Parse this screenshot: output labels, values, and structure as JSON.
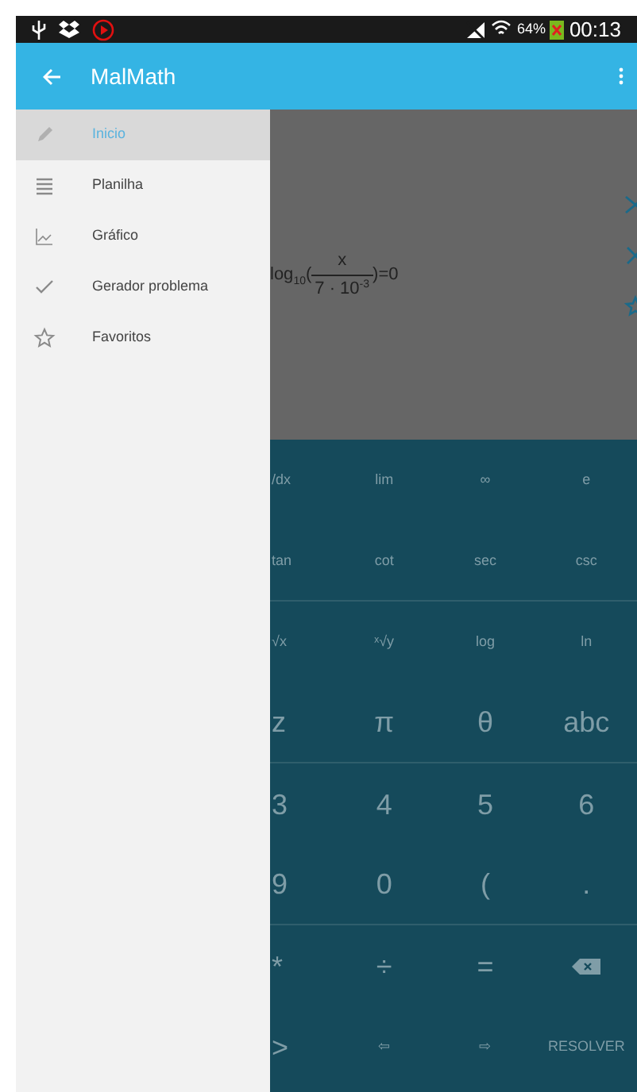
{
  "status_bar": {
    "battery_text": "64%",
    "time": "00:13"
  },
  "app_bar": {
    "title": "MalMath"
  },
  "drawer": {
    "items": [
      {
        "label": "Inicio",
        "selected": true,
        "kind": "pencil"
      },
      {
        "label": "Planilha",
        "selected": false,
        "kind": "list"
      },
      {
        "label": "Gráfico",
        "selected": false,
        "kind": "chart"
      },
      {
        "label": "Gerador problema",
        "selected": false,
        "kind": "check"
      },
      {
        "label": "Favoritos",
        "selected": false,
        "kind": "star"
      }
    ]
  },
  "equation": {
    "func": "log",
    "base": "10",
    "open": "(",
    "numerator": "x",
    "denominator": "7 · 10",
    "exponent": "-3",
    "tail": ")=0"
  },
  "keypad": {
    "rows": [
      [
        {
          "label": "/dx",
          "kind": "fn"
        },
        {
          "label": "lim",
          "kind": "fn"
        },
        {
          "label": "∞",
          "kind": "fn"
        },
        {
          "label": "e",
          "kind": "fn"
        }
      ],
      [
        {
          "label": "tan",
          "kind": "fn"
        },
        {
          "label": "cot",
          "kind": "fn"
        },
        {
          "label": "sec",
          "kind": "fn"
        },
        {
          "label": "csc",
          "kind": "fn"
        }
      ],
      [
        {
          "label": "√x",
          "kind": "fn"
        },
        {
          "label": "ˣ√y",
          "kind": "fn"
        },
        {
          "label": "log",
          "kind": "fn"
        },
        {
          "label": "ln",
          "kind": "fn"
        }
      ],
      [
        {
          "label": "z",
          "kind": "big"
        },
        {
          "label": "π",
          "kind": "big"
        },
        {
          "label": "θ",
          "kind": "big"
        },
        {
          "label": "abc",
          "kind": "big"
        }
      ],
      [
        {
          "label": "3",
          "kind": "big"
        },
        {
          "label": "4",
          "kind": "big"
        },
        {
          "label": "5",
          "kind": "big"
        },
        {
          "label": "6",
          "kind": "big"
        }
      ],
      [
        {
          "label": "9",
          "kind": "big"
        },
        {
          "label": "0",
          "kind": "big"
        },
        {
          "label": "(",
          "kind": "big"
        },
        {
          "label": ".",
          "kind": "big"
        }
      ],
      [
        {
          "label": "*",
          "kind": "big"
        },
        {
          "label": "÷",
          "kind": "big"
        },
        {
          "label": "=",
          "kind": "big"
        },
        {
          "kind": "backspace"
        }
      ],
      [
        {
          "label": ">",
          "kind": "big"
        },
        {
          "label": "⇦",
          "kind": "fn"
        },
        {
          "label": "⇨",
          "kind": "fn"
        },
        {
          "label": "RESOLVER",
          "kind": "fn"
        }
      ]
    ]
  }
}
